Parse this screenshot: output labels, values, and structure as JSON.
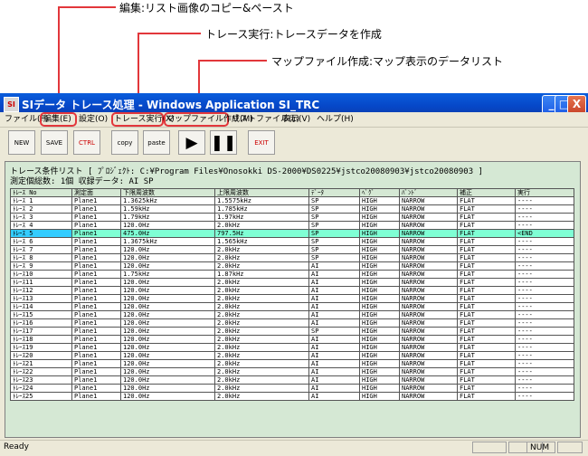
{
  "callouts": [
    {
      "text": "編集:リスト画像のコピー&ペースト"
    },
    {
      "text": "トレース実行:トレースデータを作成"
    },
    {
      "text": "マップファイル作成:マップ表示のデータリスト"
    }
  ],
  "window": {
    "title": "SIデータ トレース処理 - Windows Application SI_TRC",
    "min": "_",
    "max": "□",
    "close": "X"
  },
  "menu": [
    "ファイル(F)",
    "編集(E)",
    "設定(O)",
    "トレース実行(X)",
    "マップファイル作成(M)",
    "リストファイル(L)",
    "表示(V)",
    "ヘルプ(H)"
  ],
  "toolbar": {
    "new": "NEW",
    "save": "SAVE",
    "ctrl": "CTRL",
    "copy": "copy",
    "paste": "paste",
    "play": "▶",
    "pause": "❚❚",
    "exit": "EXIT"
  },
  "info": {
    "line1_label": "トレース条件リスト",
    "line1_path": "[ ﾌﾟﾛｼﾞｪｸﾄ: C:¥Program Files¥Onosokki DS-2000¥DS0225¥jstco20080903¥jstco20080903 ]",
    "line2": "測定個総数: 1個         収録データ: AI   SP"
  },
  "table": {
    "headers": [
      "ﾄﾚｰｽ No",
      "測定面",
      "下限周波数",
      "上限周波数",
      "ﾃﾞｰﾀ",
      "ﾍﾞｸﾞ",
      "ﾊﾞﾝﾄﾞ",
      "補正",
      "実行"
    ],
    "rows": [
      [
        "ﾄﾚｰｽ 1",
        "Plane1",
        "1.3625kHz",
        "1.5575kHz",
        "SP",
        "HIGH",
        "NARROW",
        "FLAT",
        "----"
      ],
      [
        "ﾄﾚｰｽ 2",
        "Plane1",
        "1.59kHz",
        "1.785kHz",
        "SP",
        "HIGH",
        "NARROW",
        "FLAT",
        "----"
      ],
      [
        "ﾄﾚｰｽ 3",
        "Plane1",
        "1.79kHz",
        "1.97kHz",
        "SP",
        "HIGH",
        "NARROW",
        "FLAT",
        "----"
      ],
      [
        "ﾄﾚｰｽ 4",
        "Plane1",
        "120.0Hz",
        "2.0kHz",
        "SP",
        "HIGH",
        "NARROW",
        "FLAT",
        "----"
      ],
      [
        "ﾄﾚｰｽ 5",
        "Plane1",
        "475.0Hz",
        "797.5Hz",
        "SP",
        "HIGH",
        "NARROW",
        "FLAT",
        "<END"
      ],
      [
        "ﾄﾚｰｽ 6",
        "Plane1",
        "1.3675kHz",
        "1.565kHz",
        "SP",
        "HIGH",
        "NARROW",
        "FLAT",
        "----"
      ],
      [
        "ﾄﾚｰｽ 7",
        "Plane1",
        "120.0Hz",
        "2.0kHz",
        "SP",
        "HIGH",
        "NARROW",
        "FLAT",
        "----"
      ],
      [
        "ﾄﾚｰｽ 8",
        "Plane1",
        "120.0Hz",
        "2.0kHz",
        "SP",
        "HIGH",
        "NARROW",
        "FLAT",
        "----"
      ],
      [
        "ﾄﾚｰｽ 9",
        "Plane1",
        "120.0Hz",
        "2.0kHz",
        "AI",
        "HIGH",
        "NARROW",
        "FLAT",
        "----"
      ],
      [
        "ﾄﾚｰｽ10",
        "Plane1",
        "1.75kHz",
        "1.87kHz",
        "AI",
        "HIGH",
        "NARROW",
        "FLAT",
        "----"
      ],
      [
        "ﾄﾚｰｽ11",
        "Plane1",
        "120.0Hz",
        "2.0kHz",
        "AI",
        "HIGH",
        "NARROW",
        "FLAT",
        "----"
      ],
      [
        "ﾄﾚｰｽ12",
        "Plane1",
        "120.0Hz",
        "2.0kHz",
        "AI",
        "HIGH",
        "NARROW",
        "FLAT",
        "----"
      ],
      [
        "ﾄﾚｰｽ13",
        "Plane1",
        "120.0Hz",
        "2.0kHz",
        "AI",
        "HIGH",
        "NARROW",
        "FLAT",
        "----"
      ],
      [
        "ﾄﾚｰｽ14",
        "Plane1",
        "120.0Hz",
        "2.0kHz",
        "AI",
        "HIGH",
        "NARROW",
        "FLAT",
        "----"
      ],
      [
        "ﾄﾚｰｽ15",
        "Plane1",
        "120.0Hz",
        "2.0kHz",
        "AI",
        "HIGH",
        "NARROW",
        "FLAT",
        "----"
      ],
      [
        "ﾄﾚｰｽ16",
        "Plane1",
        "120.0Hz",
        "2.0kHz",
        "AI",
        "HIGH",
        "NARROW",
        "FLAT",
        "----"
      ],
      [
        "ﾄﾚｰｽ17",
        "Plane1",
        "120.0Hz",
        "2.0kHz",
        "SP",
        "HIGH",
        "NARROW",
        "FLAT",
        "----"
      ],
      [
        "ﾄﾚｰｽ18",
        "Plane1",
        "120.0Hz",
        "2.0kHz",
        "AI",
        "HIGH",
        "NARROW",
        "FLAT",
        "----"
      ],
      [
        "ﾄﾚｰｽ19",
        "Plane1",
        "120.0Hz",
        "2.0kHz",
        "AI",
        "HIGH",
        "NARROW",
        "FLAT",
        "----"
      ],
      [
        "ﾄﾚｰｽ20",
        "Plane1",
        "120.0Hz",
        "2.0kHz",
        "AI",
        "HIGH",
        "NARROW",
        "FLAT",
        "----"
      ],
      [
        "ﾄﾚｰｽ21",
        "Plane1",
        "120.0Hz",
        "2.0kHz",
        "AI",
        "HIGH",
        "NARROW",
        "FLAT",
        "----"
      ],
      [
        "ﾄﾚｰｽ22",
        "Plane1",
        "120.0Hz",
        "2.0kHz",
        "AI",
        "HIGH",
        "NARROW",
        "FLAT",
        "----"
      ],
      [
        "ﾄﾚｰｽ23",
        "Plane1",
        "120.0Hz",
        "2.0kHz",
        "AI",
        "HIGH",
        "NARROW",
        "FLAT",
        "----"
      ],
      [
        "ﾄﾚｰｽ24",
        "Plane1",
        "120.0Hz",
        "2.0kHz",
        "AI",
        "HIGH",
        "NARROW",
        "FLAT",
        "----"
      ],
      [
        "ﾄﾚｰｽ25",
        "Plane1",
        "120.0Hz",
        "2.0kHz",
        "AI",
        "HIGH",
        "NARROW",
        "FLAT",
        "----"
      ]
    ],
    "selected_row": 5
  },
  "status": {
    "text": "Ready",
    "num": "NUM"
  },
  "colors": {
    "highlight": "#e2373b",
    "panel": "#d5e8d4",
    "selected_row": "#7fffd4"
  }
}
